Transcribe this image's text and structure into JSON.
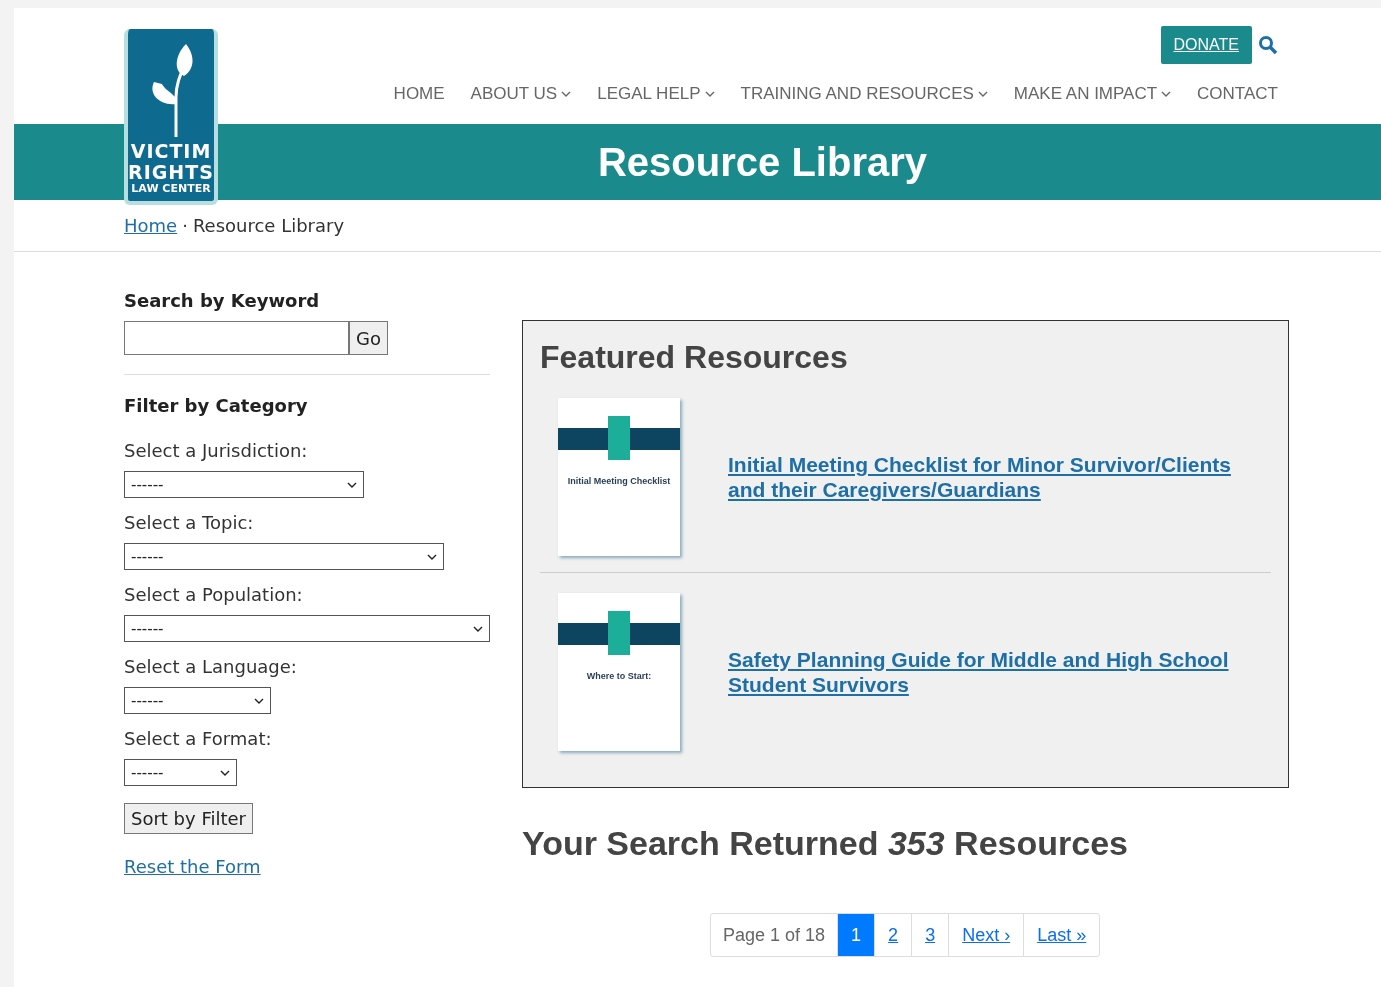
{
  "logo": {
    "lines": [
      "VICTIM",
      "RIGHTS",
      "LAW CENTER"
    ]
  },
  "donate": "DONATE",
  "nav": [
    {
      "label": "HOME",
      "dropdown": false
    },
    {
      "label": "ABOUT US",
      "dropdown": true
    },
    {
      "label": "LEGAL HELP",
      "dropdown": true
    },
    {
      "label": "TRAINING AND RESOURCES",
      "dropdown": true
    },
    {
      "label": "MAKE AN IMPACT",
      "dropdown": true
    },
    {
      "label": "CONTACT",
      "dropdown": false
    }
  ],
  "banner_title": "Resource Library",
  "breadcrumb": {
    "home": "Home",
    "separator": "·",
    "current": "Resource Library"
  },
  "search": {
    "heading": "Search by Keyword",
    "button": "Go"
  },
  "filter": {
    "heading": "Filter by Category",
    "selects": [
      {
        "label": "Select a Jurisdiction:",
        "value": "------"
      },
      {
        "label": "Select a Topic:",
        "value": "------"
      },
      {
        "label": "Select a Population:",
        "value": "------"
      },
      {
        "label": "Select a Language:",
        "value": "------"
      },
      {
        "label": "Select a Format:",
        "value": "------"
      }
    ],
    "sort_button": "Sort by Filter",
    "reset_link": "Reset the Form"
  },
  "featured": {
    "title": "Featured Resources",
    "items": [
      {
        "link": "Initial Meeting Checklist for Minor Survivor/Clients and their Caregivers/Guardians",
        "cover_title": "Initial Meeting Checklist"
      },
      {
        "link": "Safety Planning Guide for Middle and High School Student Survivors",
        "cover_title": "Where to Start:"
      }
    ]
  },
  "results_heading": "Your Search Returned *353* Resources",
  "pagination": {
    "info": "Page 1 of 18",
    "pages": [
      {
        "label": "1",
        "selected": true
      },
      {
        "label": "2",
        "selected": false
      },
      {
        "label": "3",
        "selected": false
      }
    ],
    "next": "Next ›",
    "last": "Last »"
  }
}
